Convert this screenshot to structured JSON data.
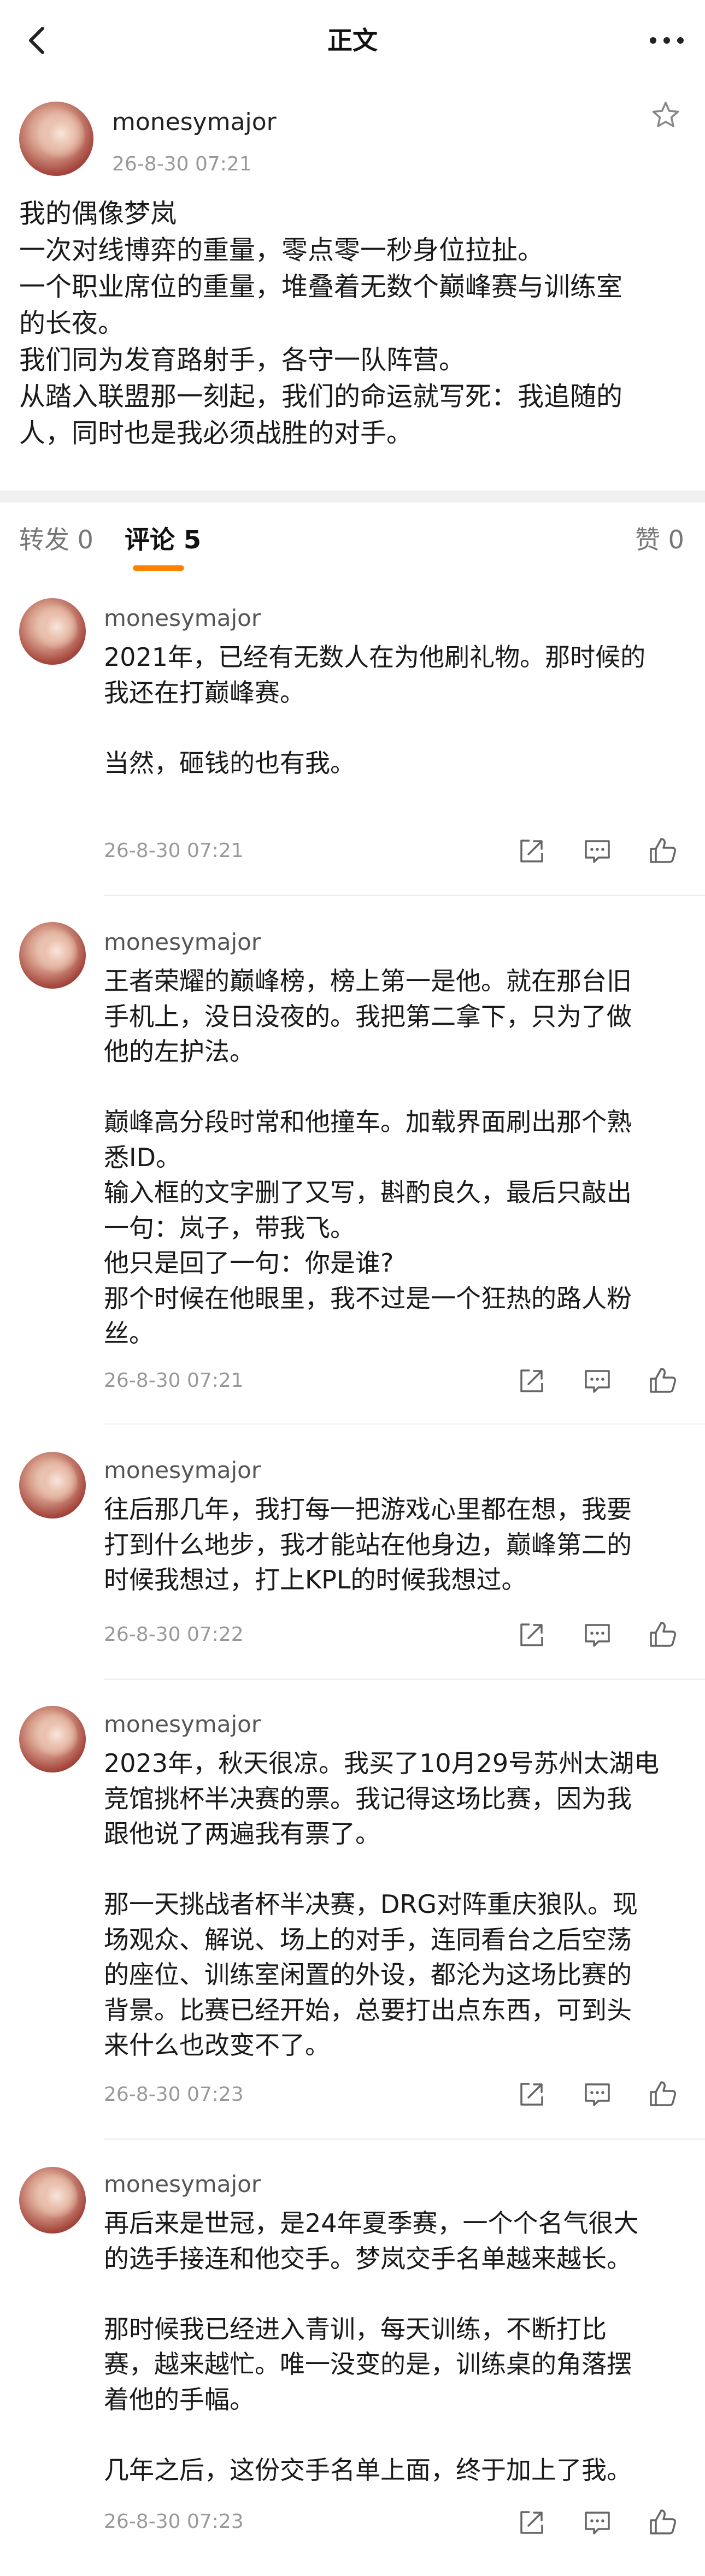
{
  "nav": {
    "title": "正文"
  },
  "post": {
    "username": "monesymajor",
    "time": "26-8-30 07:21",
    "lines": [
      "我的偶像梦岚",
      "一次对线博弈的重量，零点零一秒身位拉扯。",
      "一个职业席位的重量，堆叠着无数个巅峰赛与训练室",
      "的长夜。",
      "我们同为发育路射手，各守一队阵营。",
      "从踏入联盟那一刻起，我们的命运就写死：我追随的",
      "人，同时也是我必须战胜的对手。"
    ]
  },
  "tabs": {
    "repost": "转发 0",
    "comments": "评论 5",
    "likes": "赞 0"
  },
  "icons": [
    "back-icon",
    "more-icon",
    "star-icon",
    "share-icon",
    "comment-icon",
    "like-icon"
  ],
  "colors": {
    "accent": "#ff8200",
    "muted": "#999999",
    "divider": "#f0f0f0"
  },
  "comments": [
    {
      "username": "monesymajor",
      "time": "26-8-30 07:21",
      "lines": [
        "2021年，已经有无数人在为他刷礼物。那时候的",
        "我还在打巅峰赛。",
        "",
        "当然，砸钱的也有我。"
      ]
    },
    {
      "username": "monesymajor",
      "time": "26-8-30 07:21",
      "lines": [
        "王者荣耀的巅峰榜，榜上第一是他。就在那台旧",
        "手机上，没日没夜的。我把第二拿下，只为了做",
        "他的左护法。",
        "",
        "巅峰高分段时常和他撞车。加载界面刷出那个熟",
        "悉ID。",
        "输入框的文字删了又写，斟酌良久，最后只敲出",
        "一句：岚子，带我飞。",
        "他只是回了一句：你是谁?",
        "那个时候在他眼里，我不过是一个狂热的路人粉",
        "丝。"
      ]
    },
    {
      "username": "monesymajor",
      "time": "26-8-30 07:22",
      "lines": [
        "往后那几年，我打每一把游戏心里都在想，我要",
        "打到什么地步，我才能站在他身边，巅峰第二的",
        "时候我想过，打上KPL的时候我想过。"
      ]
    },
    {
      "username": "monesymajor",
      "time": "26-8-30 07:23",
      "lines": [
        "2023年，秋天很凉。我买了10月29号苏州太湖电",
        "竞馆挑杯半决赛的票。我记得这场比赛，因为我",
        "跟他说了两遍我有票了。",
        "",
        "那一天挑战者杯半决赛，DRG对阵重庆狼队。现",
        "场观众、解说、场上的对手，连同看台之后空荡",
        "的座位、训练室闲置的外设，都沦为这场比赛的",
        "背景。比赛已经开始，总要打出点东西，可到头",
        "来什么也改变不了。"
      ]
    },
    {
      "username": "monesymajor",
      "time": "26-8-30 07:23",
      "lines": [
        "再后来是世冠，是24年夏季赛，一个个名气很大",
        "的选手接连和他交手。梦岚交手名单越来越长。",
        "",
        "那时候我已经进入青训，每天训练，不断打比",
        "赛，越来越忙。唯一没变的是，训练桌的角落摆",
        "着他的手幅。",
        "",
        "几年之后，这份交手名单上面，终于加上了我。"
      ]
    }
  ]
}
